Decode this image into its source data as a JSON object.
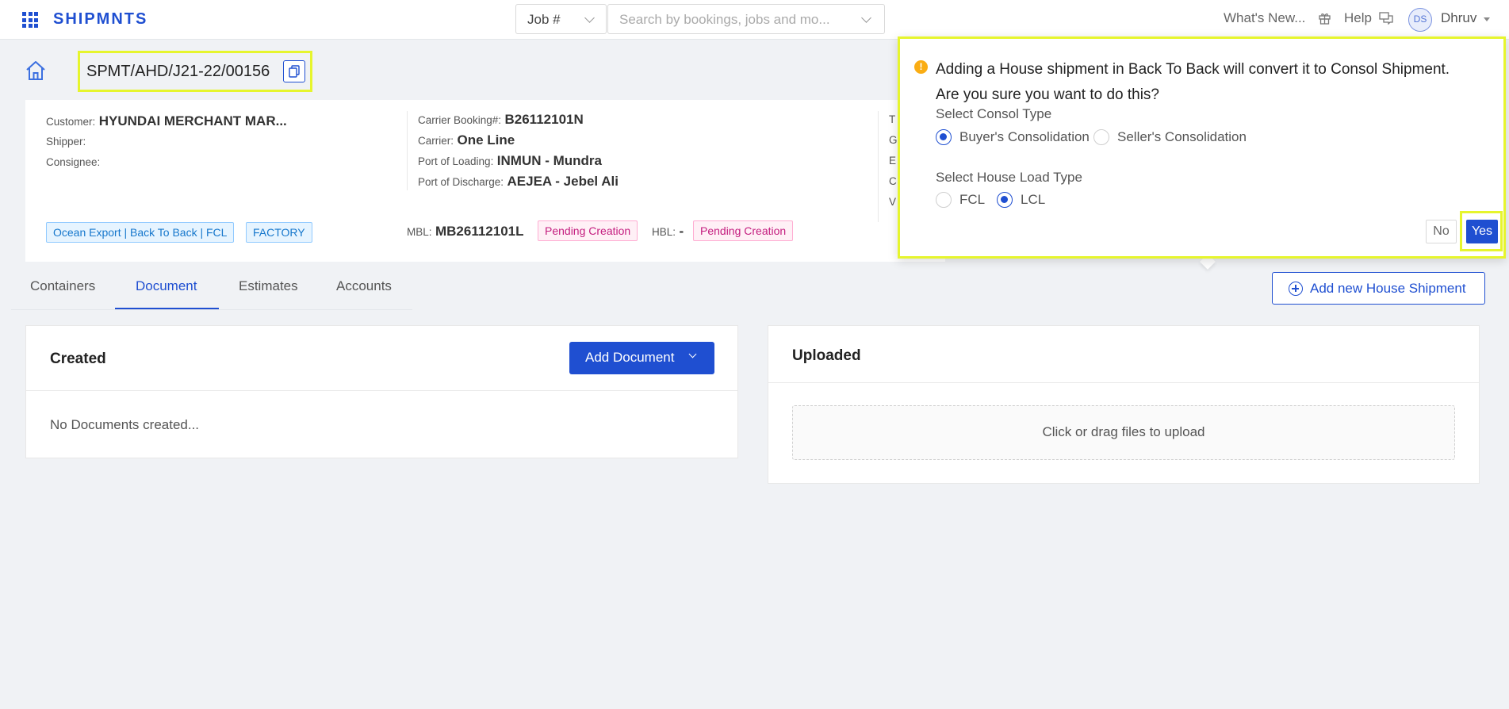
{
  "topbar": {
    "logo": "SHIPMNTS",
    "job_select": "Job #",
    "search_placeholder": "Search by bookings, jobs and mo...",
    "whats_new": "What's New...",
    "help": "Help",
    "avatar_initials": "DS",
    "username": "Dhruv"
  },
  "header": {
    "job_number": "SPMT/AHD/J21-22/00156"
  },
  "info": {
    "customer_label": "Customer:",
    "customer_value": "HYUNDAI MERCHANT MAR...",
    "shipper_label": "Shipper:",
    "consignee_label": "Consignee:",
    "carrier_booking_label": "Carrier Booking#:",
    "carrier_booking_value": "B26112101N",
    "carrier_label": "Carrier:",
    "carrier_value": "One Line",
    "pol_label": "Port of Loading:",
    "pol_value": "INMUN - Mundra",
    "pod_label": "Port of Discharge:",
    "pod_value": "AEJEA - Jebel Ali",
    "col3_letters": [
      "T",
      "G",
      "E",
      "C",
      "V"
    ],
    "tag_mode": "Ocean Export | Back To Back | FCL",
    "tag_factory": "FACTORY",
    "mbl_label": "MBL:",
    "mbl_value": "MB26112101L",
    "mbl_status": "Pending Creation",
    "hbl_label": "HBL:",
    "hbl_value": "-",
    "hbl_status": "Pending Creation"
  },
  "tabs": [
    {
      "label": "Containers",
      "active": false
    },
    {
      "label": "Document",
      "active": true
    },
    {
      "label": "Estimates",
      "active": false
    },
    {
      "label": "Accounts",
      "active": false
    }
  ],
  "add_house_button": "Add new House Shipment",
  "created_panel": {
    "title": "Created",
    "add_button": "Add Document",
    "empty": "No Documents created..."
  },
  "uploaded_panel": {
    "title": "Uploaded",
    "dropzone": "Click or drag files to upload"
  },
  "popconfirm": {
    "message_line1": "Adding a House shipment in Back To Back will convert it to Consol Shipment.",
    "message_line2": "Are you sure you want to do this?",
    "consol_label": "Select Consol Type",
    "consol_options": [
      {
        "label": "Buyer's Consolidation",
        "selected": true
      },
      {
        "label": "Seller's Consolidation",
        "selected": false
      }
    ],
    "load_label": "Select House Load Type",
    "load_options": [
      {
        "label": "FCL",
        "selected": false
      },
      {
        "label": "LCL",
        "selected": true
      }
    ],
    "no_button": "No",
    "yes_button": "Yes"
  },
  "colors": {
    "primary": "#1f4fd1",
    "highlight": "#e6f52d",
    "warning": "#faad14",
    "tag_pink": "#c41d7f"
  }
}
